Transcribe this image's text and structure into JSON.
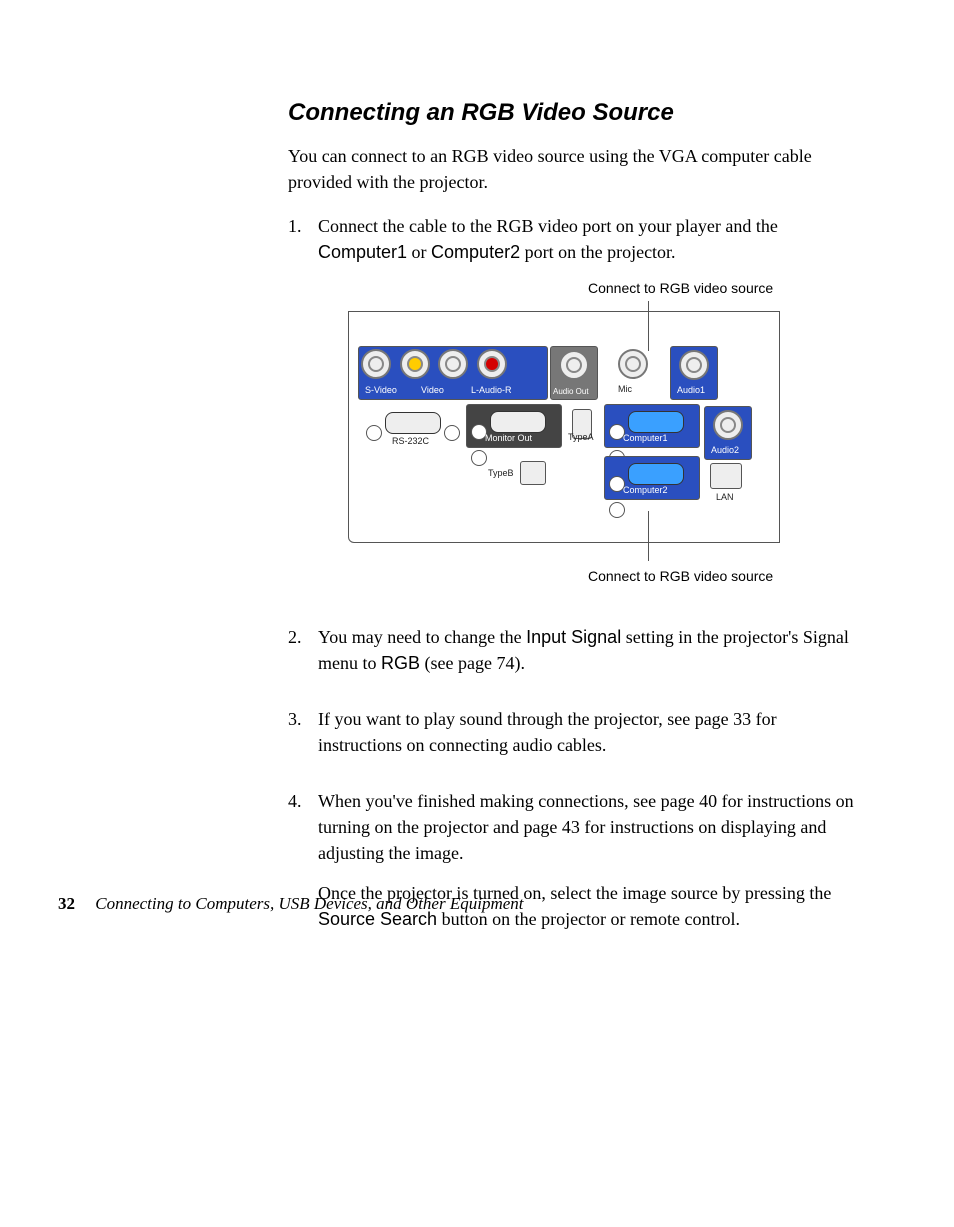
{
  "heading": "Connecting an RGB Video Source",
  "intro": "You can connect to an RGB video source using the VGA computer cable provided with the projector.",
  "steps": {
    "s1a": "Connect the cable to the RGB video port on your player and the ",
    "s1_c1": "Computer1",
    "s1_or": " or ",
    "s1_c2": "Computer2",
    "s1b": " port on the projector.",
    "s2a": "You may need to change the ",
    "s2_input": "Input Signal",
    "s2b": " setting in the projector's Signal menu to ",
    "s2_rgb": "RGB",
    "s2c": " (see page 74).",
    "s3": "If you want to play sound through the projector, see page 33 for instructions on connecting audio cables.",
    "s4": "When you've finished making connections, see page 40 for instructions on turning on the projector and page 43 for instructions on displaying and adjusting the image.",
    "s4p2a": "Once the projector is turned on, select the image source by pressing the ",
    "s4_src": "Source Search",
    "s4p2b": " button on the projector or remote control."
  },
  "diagram": {
    "callout_top": "Connect to RGB video source",
    "callout_bottom": "Connect to RGB video source",
    "labels": {
      "svideo": "S-Video",
      "video": "Video",
      "laudior": "L-Audio-R",
      "audioout": "Audio Out",
      "mic": "Mic",
      "audio1": "Audio1",
      "audio2": "Audio2",
      "rs232": "RS-232C",
      "monitorout": "Monitor Out",
      "typea": "TypeA",
      "typeb": "TypeB",
      "computer1": "Computer1",
      "computer2": "Computer2",
      "lan": "LAN"
    }
  },
  "footer": {
    "page": "32",
    "title": "Connecting to Computers, USB Devices, and Other Equipment"
  }
}
